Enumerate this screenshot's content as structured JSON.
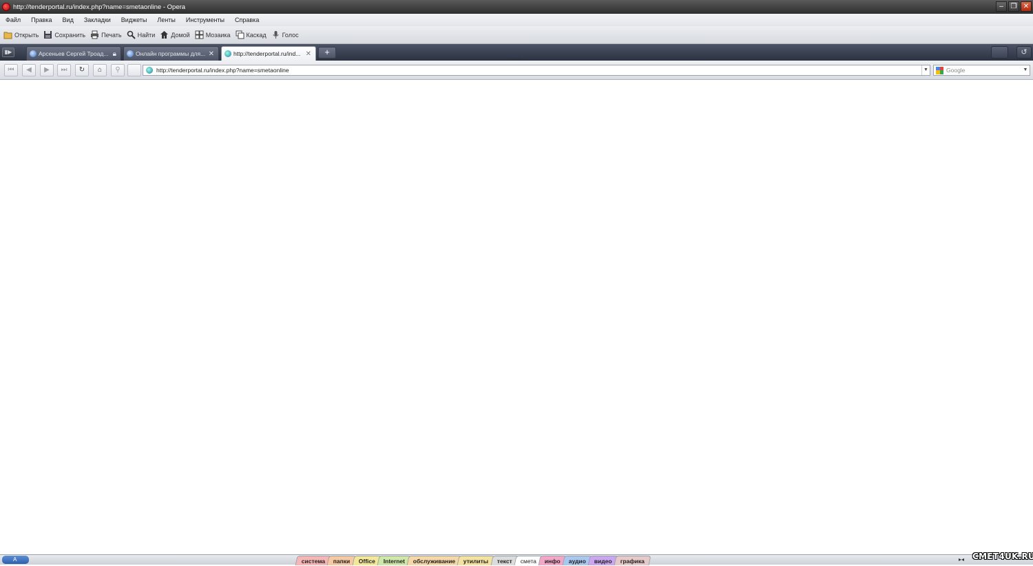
{
  "window": {
    "title": "http://tenderportal.ru/index.php?name=smetaonline - Opera",
    "minimize": "–",
    "restore": "❐",
    "close": "✕"
  },
  "menu": [
    "Файл",
    "Правка",
    "Вид",
    "Закладки",
    "Виджеты",
    "Ленты",
    "Инструменты",
    "Справка"
  ],
  "toolbar": {
    "open": "Открыть",
    "save": "Сохранить",
    "print": "Печать",
    "find": "Найти",
    "home": "Домой",
    "tile": "Мозаика",
    "cascade": "Каскад",
    "voice": "Голос"
  },
  "tabs": [
    {
      "label": "Арсеньев Сергей Троад...",
      "active": false,
      "locked": true
    },
    {
      "label": "Онлайн программы для...",
      "active": false,
      "closable": true
    },
    {
      "label": "http://tenderportal.ru/ind...",
      "active": true,
      "closable": true
    }
  ],
  "tab_controls": {
    "new_tab": "+",
    "panel": "▮▶",
    "closed_tabs": "↺"
  },
  "address": {
    "url": "http://tenderportal.ru/index.php?name=smetaonline",
    "search_placeholder": "Google",
    "dropdown": "▼"
  },
  "taskbar": {
    "lang": "A",
    "quick_launch": [
      {
        "label": "система",
        "color": "#f6b6b6"
      },
      {
        "label": "папки",
        "color": "#f7c9a3"
      },
      {
        "label": "Office",
        "color": "#f3e79a"
      },
      {
        "label": "Internet",
        "color": "#cfe8a8"
      },
      {
        "label": "обслуживание",
        "color": "#f5d7a8"
      },
      {
        "label": "утилиты",
        "color": "#f3e2a0"
      },
      {
        "label": "текст",
        "color": "#dcdcdc"
      },
      {
        "label": "смета",
        "color": "#ffffff",
        "active": true
      },
      {
        "label": "инфо",
        "color": "#f4a6c8"
      },
      {
        "label": "аудио",
        "color": "#a8c8f0"
      },
      {
        "label": "видео",
        "color": "#c9a6ef"
      },
      {
        "label": "графика",
        "color": "#e6c9c9"
      }
    ]
  },
  "watermark": "СМЕТ4UK.RU"
}
